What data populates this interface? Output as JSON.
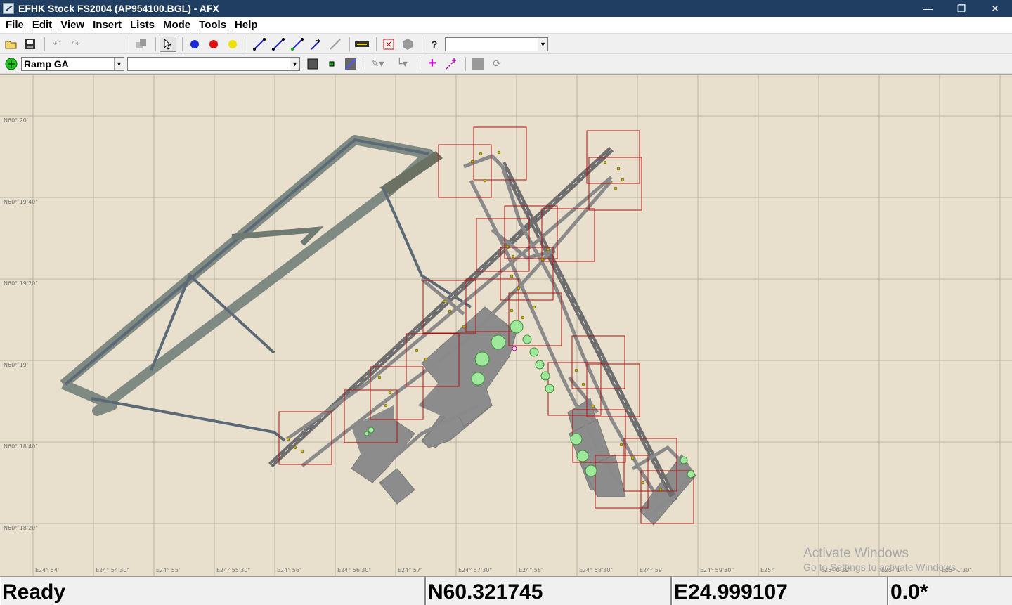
{
  "window": {
    "title": "EFHK Stock FS2004 (AP954100.BGL) - AFX",
    "controls": [
      "—",
      "❐",
      "✕"
    ]
  },
  "menu": [
    "File",
    "Edit",
    "View",
    "Insert",
    "Lists",
    "Mode",
    "Tools",
    "Help"
  ],
  "toolbar1": {
    "dot_colors": [
      "#1a28d6",
      "#e01010",
      "#f0e000"
    ],
    "combo_value": ""
  },
  "toolbar2": {
    "ramp_select": "Ramp GA",
    "object_select": ""
  },
  "map": {
    "lat_labels": [
      "N60° 20'",
      "N60° 19'40\"",
      "N60° 19'20\"",
      "N60° 19'",
      "N60° 18'40\"",
      "N60° 18'20\""
    ],
    "lon_labels": [
      "E24° 54'",
      "E24° 54'30\"",
      "E24° 55'",
      "E24° 55'30\"",
      "E24° 56'",
      "E24° 56'30\"",
      "E24° 57'",
      "E24° 57'30\"",
      "E24° 58'",
      "E24° 58'30\"",
      "E24° 59'",
      "E24° 59'30\"",
      "E25°",
      "E25° 0'30\"",
      "E25° 1'",
      "E25° 1'30\""
    ],
    "background_color": "#e8e0cc",
    "taxiway_color": "#8a8a8a",
    "runway_color": "#6e6e6e",
    "box_color": "#b01010",
    "gate_color": "#9de89a"
  },
  "watermark": {
    "title": "Activate Windows",
    "subtitle": "Go to Settings to activate Windows."
  },
  "status": {
    "message": "Ready",
    "latitude": "N60.321745",
    "longitude": "E24.999107",
    "heading": "0.0*"
  }
}
